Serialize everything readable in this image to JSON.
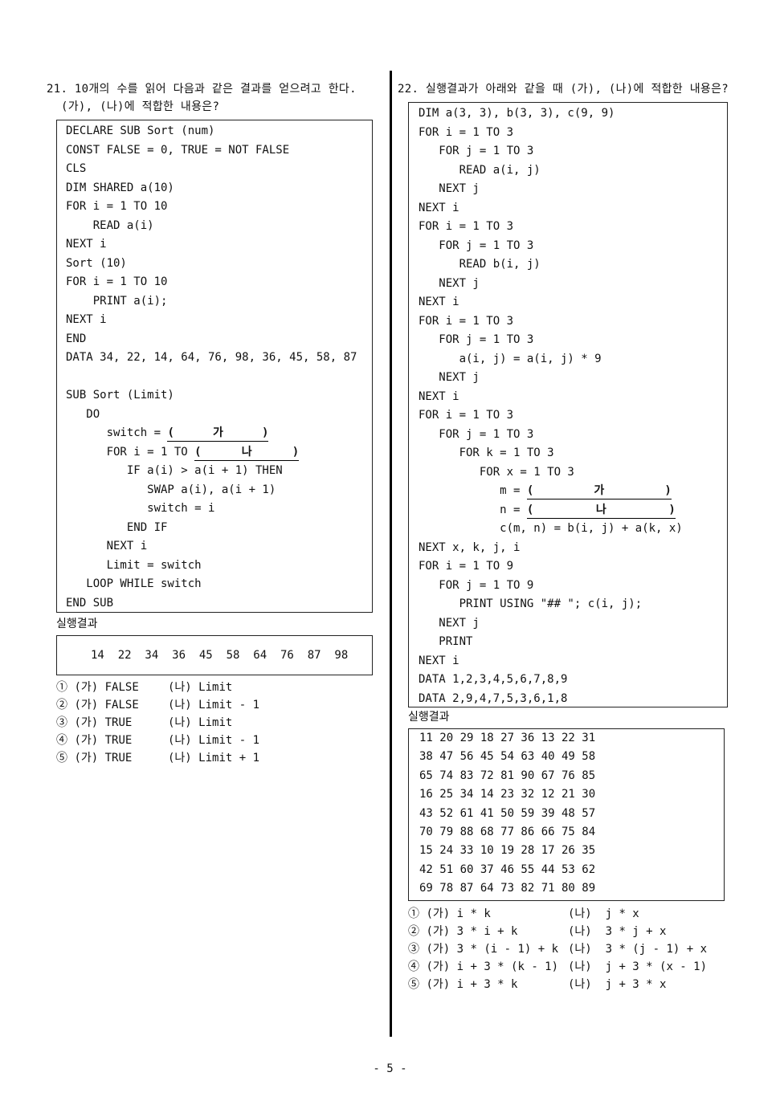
{
  "q21": {
    "title_line1": "21. 10개의 수를 읽어 다음과 같은 결과를 얻으려고 한다.",
    "title_line2": "(가), (나)에 적합한 내용은?",
    "code": [
      "DECLARE SUB Sort (num)",
      "CONST FALSE = 0, TRUE = NOT FALSE",
      "CLS",
      "DIM SHARED a(10)",
      "FOR i = 1 TO 10",
      "    READ a(i)",
      "NEXT i",
      "Sort (10)",
      "FOR i = 1 TO 10",
      "    PRINT a(i);",
      "NEXT i",
      "END",
      "DATA 34, 22, 14, 64, 76, 98, 36, 45, 58, 87",
      "",
      "SUB Sort (Limit)",
      "   DO",
      "      switch = ",
      "      FOR i = 1 TO ",
      "         IF a(i) > a(i + 1) THEN",
      "            SWAP a(i), a(i + 1)",
      "            switch = i",
      "         END IF",
      "      NEXT i",
      "      Limit = switch",
      "   LOOP WHILE switch",
      "END SUB"
    ],
    "blank_ga": "가",
    "blank_na": "나",
    "result_label": "실행결과",
    "result": "14  22  34  36  45  58  64  76  87  98",
    "choices": [
      {
        "num": "①",
        "a": "(가) FALSE",
        "b": "(나) Limit"
      },
      {
        "num": "②",
        "a": "(가) FALSE",
        "b": "(나) Limit - 1"
      },
      {
        "num": "③",
        "a": "(가) TRUE",
        "b": "(나) Limit"
      },
      {
        "num": "④",
        "a": "(가) TRUE",
        "b": "(나) Limit - 1"
      },
      {
        "num": "⑤",
        "a": "(가) TRUE",
        "b": "(나) Limit + 1"
      }
    ]
  },
  "q22": {
    "title": "22. 실행결과가 아래와 같을 때 (가), (나)에 적합한 내용은?",
    "code": [
      "DIM a(3, 3), b(3, 3), c(9, 9)",
      "FOR i = 1 TO 3",
      "   FOR j = 1 TO 3",
      "      READ a(i, j)",
      "   NEXT j",
      "NEXT i",
      "FOR i = 1 TO 3",
      "   FOR j = 1 TO 3",
      "      READ b(i, j)",
      "   NEXT j",
      "NEXT i",
      "FOR i = 1 TO 3",
      "   FOR j = 1 TO 3",
      "      a(i, j) = a(i, j) * 9",
      "   NEXT j",
      "NEXT i",
      "FOR i = 1 TO 3",
      "   FOR j = 1 TO 3",
      "      FOR k = 1 TO 3",
      "         FOR x = 1 TO 3",
      "            m = ",
      "            n = ",
      "            c(m, n) = b(i, j) + a(k, x)",
      "NEXT x, k, j, i",
      "FOR i = 1 TO 9",
      "   FOR j = 1 TO 9",
      "      PRINT USING \"## \"; c(i, j);",
      "   NEXT j",
      "   PRINT",
      "NEXT i",
      "DATA 1,2,3,4,5,6,7,8,9",
      "DATA 2,9,4,7,5,3,6,1,8"
    ],
    "blank_ga": "가",
    "blank_na": "나",
    "result_label": "실행결과",
    "result": [
      "11 20 29 18 27 36 13 22 31",
      "38 47 56 45 54 63 40 49 58",
      "65 74 83 72 81 90 67 76 85",
      "16 25 34 14 23 32 12 21 30",
      "43 52 61 41 50 59 39 48 57",
      "70 79 88 68 77 86 66 75 84",
      "15 24 33 10 19 28 17 26 35",
      "42 51 60 37 46 55 44 53 62",
      "69 78 87 64 73 82 71 80 89"
    ],
    "choices": [
      {
        "num": "①",
        "a": "(가) i * k",
        "b": "(나)  j * x"
      },
      {
        "num": "②",
        "a": "(가) 3 * i + k",
        "b": "(나)  3 * j + x"
      },
      {
        "num": "③",
        "a": "(가) 3 * (i - 1) + k",
        "b": "(나)  3 * (j - 1) + x"
      },
      {
        "num": "④",
        "a": "(가) i + 3 * (k - 1)",
        "b": "(나)  j + 3 * (x - 1)"
      },
      {
        "num": "⑤",
        "a": "(가) i + 3 * k",
        "b": "(나)  j + 3 * x"
      }
    ]
  },
  "footer": "- 5 -"
}
